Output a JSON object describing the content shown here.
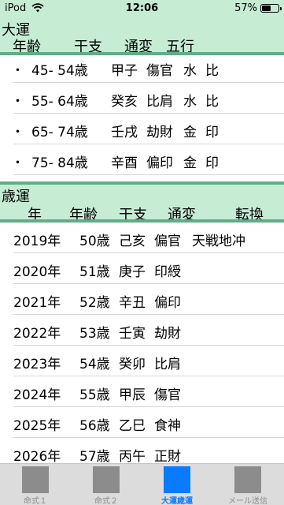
{
  "status": {
    "carrier": "iPod",
    "time": "12:06",
    "battery": "57%",
    "battery_level": 0.57
  },
  "taiun": {
    "title": "大運",
    "headers": [
      "年齢",
      "干支",
      "通変",
      "五行"
    ],
    "rows": [
      {
        "bullet": "・",
        "age": "45- 54歳",
        "kanshi": "甲子",
        "tsuhen": "傷官",
        "gogyo": "水",
        "rel": "比"
      },
      {
        "bullet": "・",
        "age": "55- 64歳",
        "kanshi": "癸亥",
        "tsuhen": "比肩",
        "gogyo": "水",
        "rel": "比"
      },
      {
        "bullet": "・",
        "age": "65- 74歳",
        "kanshi": "壬戌",
        "tsuhen": "劫財",
        "gogyo": "金",
        "rel": "印"
      },
      {
        "bullet": "・",
        "age": "75- 84歳",
        "kanshi": "辛酉",
        "tsuhen": "偏印",
        "gogyo": "金",
        "rel": "印"
      }
    ]
  },
  "saiun": {
    "title": "歳運",
    "headers": [
      "年",
      "年齢",
      "干支",
      "通変",
      "転換"
    ],
    "rows": [
      {
        "year": "2019年",
        "age": "50歳",
        "kanshi": "己亥",
        "tsuhen": "偏官",
        "tenkan": "天戦地冲"
      },
      {
        "year": "2020年",
        "age": "51歳",
        "kanshi": "庚子",
        "tsuhen": "印綬",
        "tenkan": ""
      },
      {
        "year": "2021年",
        "age": "52歳",
        "kanshi": "辛丑",
        "tsuhen": "偏印",
        "tenkan": ""
      },
      {
        "year": "2022年",
        "age": "53歳",
        "kanshi": "壬寅",
        "tsuhen": "劫財",
        "tenkan": ""
      },
      {
        "year": "2023年",
        "age": "54歳",
        "kanshi": "癸卯",
        "tsuhen": "比肩",
        "tenkan": ""
      },
      {
        "year": "2024年",
        "age": "55歳",
        "kanshi": "甲辰",
        "tsuhen": "傷官",
        "tenkan": ""
      },
      {
        "year": "2025年",
        "age": "56歳",
        "kanshi": "乙巳",
        "tsuhen": "食神",
        "tenkan": ""
      },
      {
        "year": "2026年",
        "age": "57歳",
        "kanshi": "丙午",
        "tsuhen": "正財",
        "tenkan": ""
      }
    ]
  },
  "tabs": [
    {
      "label": "命式１",
      "active": false
    },
    {
      "label": "命式２",
      "active": false
    },
    {
      "label": "大運歳運",
      "active": true
    },
    {
      "label": "メール送信",
      "active": false
    }
  ],
  "colors": {
    "header_bg": "#c6ecd4",
    "header_rule": "#5fae87",
    "tab_active": "#0a7aff",
    "tab_inactive": "#8c8c8c"
  }
}
